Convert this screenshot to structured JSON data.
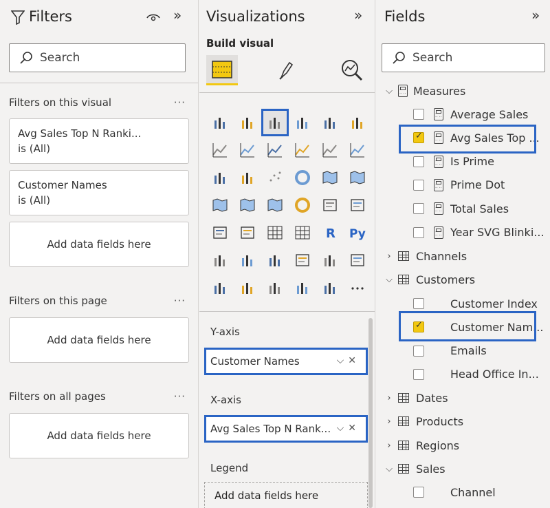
{
  "filters": {
    "title": "Filters",
    "search_placeholder": "Search",
    "visual_section": "Filters on this visual",
    "visual_cards": [
      {
        "name": "Avg Sales Top N Ranki...",
        "state": "is (All)"
      },
      {
        "name": "Customer Names",
        "state": "is (All)"
      }
    ],
    "add_label": "Add data fields here",
    "page_section": "Filters on this page",
    "all_section": "Filters on all pages",
    "more": "···"
  },
  "visualizations": {
    "title": "Visualizations",
    "build_label": "Build visual",
    "selected_icon": "clustered-bar-chart-icon",
    "icons": [
      "stacked-bar-chart-icon",
      "stacked-column-chart-icon",
      "clustered-bar-chart-icon",
      "clustered-column-chart-icon",
      "100-stacked-bar-chart-icon",
      "100-stacked-column-chart-icon",
      "line-chart-icon",
      "area-chart-icon",
      "stacked-area-chart-icon",
      "line-and-column-chart-icon",
      "line-and-clustered-column-chart-icon",
      "ribbon-chart-icon",
      "waterfall-chart-icon",
      "funnel-icon",
      "scatter-chart-icon",
      "donut-chart-icon",
      "treemap-icon",
      "map-icon",
      "filled-map-icon",
      "shape-map-icon",
      "azure-map-icon",
      "gauge-icon",
      "card-icon",
      "multi-row-card-icon",
      "kpi-icon",
      "slicer-icon",
      "table-icon",
      "matrix-icon",
      "r-visual-icon",
      "python-visual-icon",
      "key-influencers-icon",
      "decomposition-tree-icon",
      "qa-icon",
      "smart-narrative-icon",
      "goals-icon",
      "paginated-report-icon",
      "power-apps-icon",
      "power-automate-icon",
      "arrow-visual-icon",
      "custom-visual-icon",
      "insight-visual-icon",
      "more-icon"
    ],
    "wells": {
      "yaxis_label": "Y-axis",
      "yaxis_value": "Customer Names",
      "xaxis_label": "X-axis",
      "xaxis_value": "Avg Sales Top N Rank...",
      "legend_label": "Legend",
      "legend_placeholder": "Add data fields here"
    }
  },
  "fields": {
    "title": "Fields",
    "search_placeholder": "Search",
    "measures_table": "Measures",
    "measures": [
      {
        "name": "Average Sales",
        "checked": false
      },
      {
        "name": "Avg Sales Top ...",
        "checked": true
      },
      {
        "name": "Is Prime",
        "checked": false
      },
      {
        "name": "Prime Dot",
        "checked": false
      },
      {
        "name": "Total Sales",
        "checked": false
      },
      {
        "name": "Year SVG Blinki...",
        "checked": false
      }
    ],
    "channels": "Channels",
    "customers_table": "Customers",
    "customers": [
      {
        "name": "Customer Index",
        "checked": false
      },
      {
        "name": "Customer Nam...",
        "checked": true
      },
      {
        "name": "Emails",
        "checked": false
      },
      {
        "name": "Head Office In...",
        "checked": false
      }
    ],
    "dates": "Dates",
    "products": "Products",
    "regions": "Regions",
    "sales_table": "Sales",
    "sales": [
      {
        "name": "Channel",
        "checked": false
      }
    ]
  },
  "colors": {
    "highlight": "#2a64c4",
    "check": "#f2c811"
  }
}
